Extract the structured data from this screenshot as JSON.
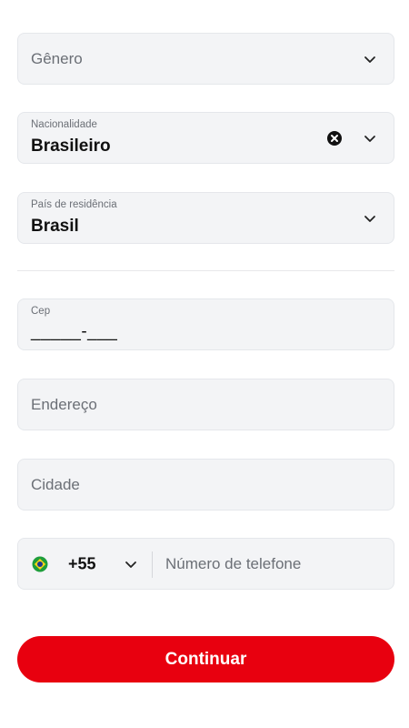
{
  "form": {
    "gender": {
      "placeholder": "Gênero"
    },
    "nationality": {
      "label": "Nacionalidade",
      "value": "Brasileiro"
    },
    "residence_country": {
      "label": "País de residência",
      "value": "Brasil"
    },
    "cep": {
      "label": "Cep",
      "mask": "_____-___"
    },
    "address": {
      "placeholder": "Endereço"
    },
    "city": {
      "placeholder": "Cidade"
    },
    "phone": {
      "country_code": "+55",
      "flag": "brazil-flag-icon",
      "placeholder": "Número de telefone"
    },
    "submit_label": "Continuar"
  },
  "colors": {
    "accent": "#e8000f",
    "field_bg": "#f3f4f6",
    "field_border": "#e5e7eb",
    "placeholder_text": "#6b6f76"
  }
}
